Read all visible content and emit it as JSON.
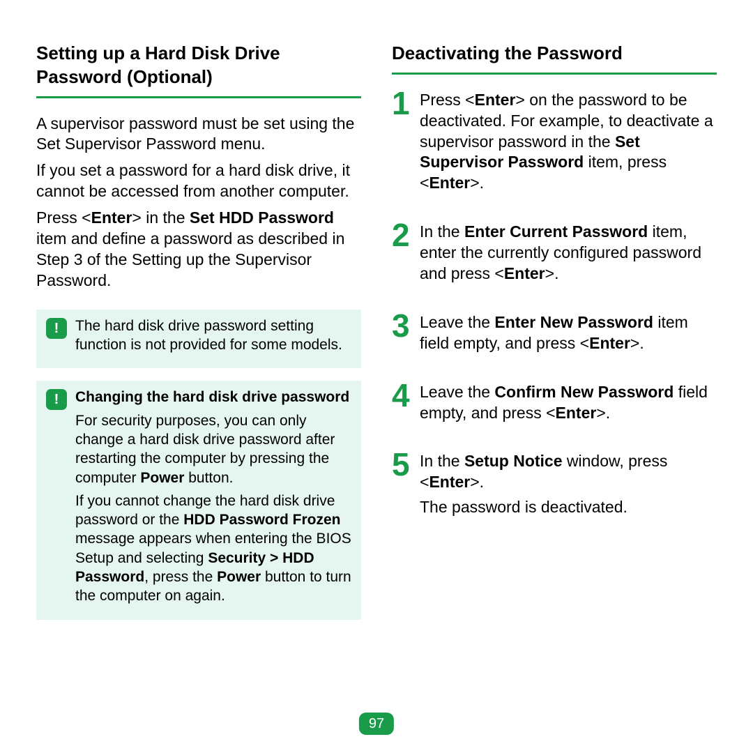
{
  "page_number": "97",
  "left": {
    "heading": "Setting up a Hard Disk Drive Password (Optional)",
    "p1": "A supervisor password must be set using the Set Supervisor Password menu.",
    "p2": "If you set a password for a hard disk drive, it cannot be accessed from another computer.",
    "p3_html": "Press &lt;<b>Enter</b>&gt; in the <b>Set HDD Password</b> item and define a password as described in Step 3 of the Setting up the Supervisor Password.",
    "note1": {
      "text": "The hard disk drive password setting function is not provided for some models."
    },
    "note2": {
      "title": "Changing the hard disk drive password",
      "p1_html": "For security purposes, you can only change a hard disk drive password after restarting the computer by pressing the computer <b>Power</b> button.",
      "p2_html": "If you cannot change the hard disk drive password or the <b>HDD Password Frozen</b> message appears when entering the BIOS Setup and selecting <b>Security > HDD Password</b>, press the <b>Power</b> button to turn the computer on again."
    }
  },
  "right": {
    "heading": "Deactivating the Password",
    "steps": [
      {
        "num": "1",
        "html": "Press &lt;<b>Enter</b>&gt; on the password to be deactivated. For example, to deactivate a supervisor password in the <b>Set Supervisor Password</b> item, press &lt;<b>Enter</b>&gt;."
      },
      {
        "num": "2",
        "html": "In the <b>Enter Current Password</b> item, enter the currently configured password and press &lt;<b>Enter</b>&gt;."
      },
      {
        "num": "3",
        "html": "Leave the <b>Enter New Password</b> item field empty, and press &lt;<b>Enter</b>&gt;."
      },
      {
        "num": "4",
        "html": "Leave the <b>Confirm New Password</b> field empty, and press &lt;<b>Enter</b>&gt;."
      },
      {
        "num": "5",
        "html": "In the <b>Setup Notice</b> window, press &lt;<b>Enter</b>&gt;.",
        "after": "The password is deactivated."
      }
    ]
  }
}
